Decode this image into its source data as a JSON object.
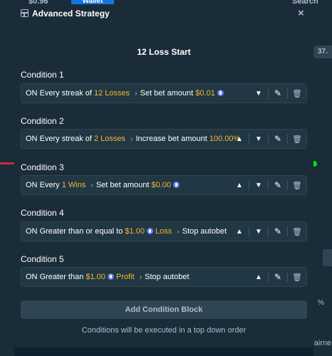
{
  "background": {
    "balance": "$0.96",
    "wallet_label": "Wallet",
    "search_label": "Search",
    "side_value": "37.",
    "percent_symbol": "%",
    "fairness_label": "Fairne"
  },
  "modal": {
    "title": "Advanced Strategy",
    "close_glyph": "×",
    "strategy_name": "12 Loss Start",
    "add_button_label": "Add Condition Block",
    "footer_note": "Conditions will be executed in a top down order"
  },
  "conditions": [
    {
      "label": "Condition 1",
      "on": "ON",
      "t1": "Every streak of",
      "v1": "12 Losses",
      "t2": "Set bet amount",
      "v2": "$0.01",
      "show_up": false
    },
    {
      "label": "Condition 2",
      "on": "ON",
      "t1": "Every streak of",
      "v1": "2 Losses",
      "t2": "Increase bet amount",
      "v2": "100.00%",
      "show_up": true
    },
    {
      "label": "Condition 3",
      "on": "ON",
      "t1": "Every",
      "v1": "1 Wins",
      "t2": "Set bet amount",
      "v2": "$0.00",
      "show_up": true
    },
    {
      "label": "Condition 4",
      "on": "ON",
      "t1": "Greater than or equal to",
      "v1": "$1.00",
      "v1b": "Loss",
      "t2": "Stop autobet",
      "show_up": true
    },
    {
      "label": "Condition 5",
      "on": "ON",
      "t1": "Greater than",
      "v1": "$1.00",
      "v1b": "Profit",
      "t2": "Stop autobet",
      "show_up": true
    }
  ],
  "icons": {
    "chevron_up": "▲",
    "chevron_down": "▼",
    "arrow": "›",
    "pencil": "✎",
    "trash": "🗑"
  },
  "colors": {
    "highlight": "#f7b731",
    "coin": "#627eea",
    "modal_bg": "#1a2c38",
    "row_bg": "#213743"
  }
}
